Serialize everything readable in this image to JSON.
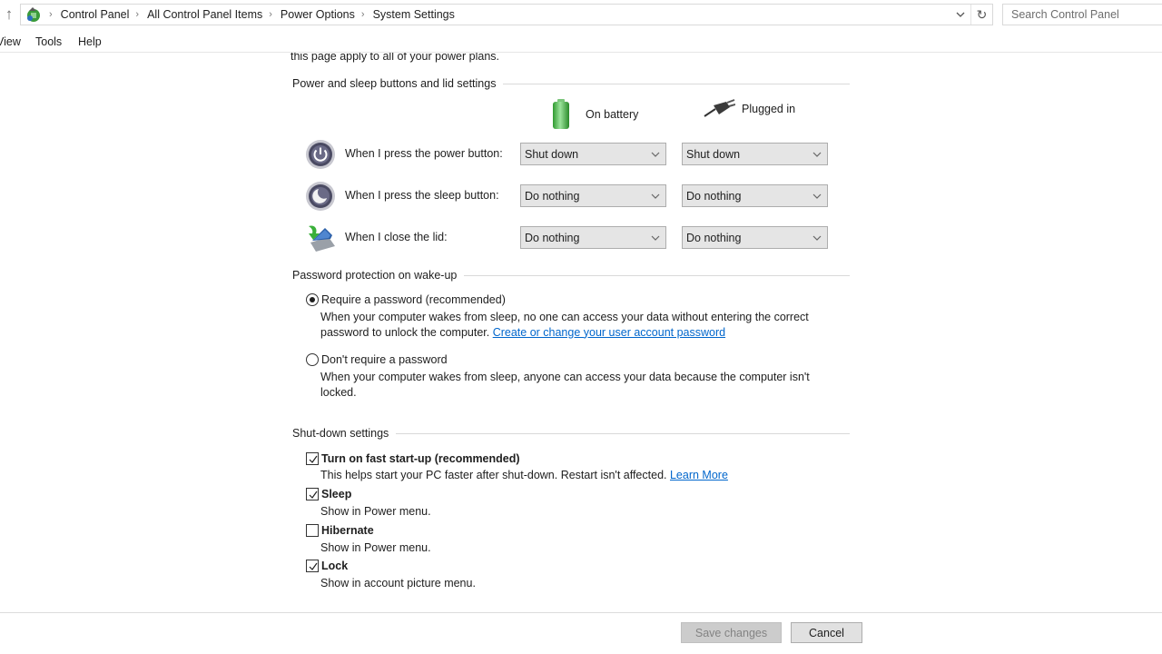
{
  "address_bar": {
    "breadcrumbs": [
      "Control Panel",
      "All Control Panel Items",
      "Power Options",
      "System Settings"
    ],
    "up_icon": "up-arrow-icon",
    "location_icon": "control-panel-icon",
    "dropdown_icon": "chevron-down-icon",
    "refresh_icon": "refresh-icon"
  },
  "search": {
    "placeholder": "Search Control Panel",
    "value": ""
  },
  "menu": {
    "items": [
      "View",
      "Tools",
      "Help"
    ]
  },
  "intro_text": "this page apply to all of your power plans.",
  "power_buttons_section": {
    "title": "Power and sleep buttons and lid settings",
    "columns": [
      {
        "label": "On battery",
        "icon": "battery-icon"
      },
      {
        "label": "Plugged in",
        "icon": "plug-icon"
      }
    ],
    "rows": [
      {
        "label": "When I press the power button:",
        "icon": "power-button-icon",
        "on_battery": "Shut down",
        "plugged_in": "Shut down"
      },
      {
        "label": "When I press the sleep button:",
        "icon": "sleep-button-icon",
        "on_battery": "Do nothing",
        "plugged_in": "Do nothing"
      },
      {
        "label": "When I close the lid:",
        "icon": "laptop-lid-icon",
        "on_battery": "Do nothing",
        "plugged_in": "Do nothing"
      }
    ]
  },
  "password_section": {
    "title": "Password protection on wake-up",
    "options": [
      {
        "label": "Require a password (recommended)",
        "selected": true,
        "description_line1": "When your computer wakes from sleep, no one can access your data without entering the correct",
        "description_line2": "password to unlock the computer.",
        "link": "Create or change your user account password"
      },
      {
        "label": "Don't require a password",
        "selected": false,
        "description_line1": "When your computer wakes from sleep, anyone can access your data because the computer isn't",
        "description_line2": "locked."
      }
    ]
  },
  "shutdown_section": {
    "title": "Shut-down settings",
    "items": [
      {
        "label": "Turn on fast start-up (recommended)",
        "checked": true,
        "description": "This helps start your PC faster after shut-down. Restart isn't affected.",
        "link": "Learn More"
      },
      {
        "label": "Sleep",
        "checked": true,
        "description": "Show in Power menu."
      },
      {
        "label": "Hibernate",
        "checked": false,
        "description": "Show in Power menu."
      },
      {
        "label": "Lock",
        "checked": true,
        "description": "Show in account picture menu."
      }
    ]
  },
  "footer": {
    "save_label": "Save changes",
    "save_enabled": false,
    "cancel_label": "Cancel"
  },
  "colors": {
    "link": "#0066cc",
    "dropdown_bg": "#e5e5e5",
    "button_bg": "#e1e1e1",
    "disabled_button_bg": "#cccccc"
  }
}
